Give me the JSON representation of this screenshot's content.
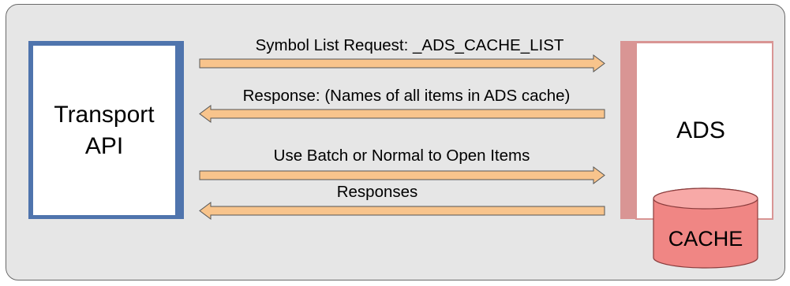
{
  "diagram": {
    "left_box": {
      "label_line1": "Transport",
      "label_line2": "API"
    },
    "right_box": {
      "label": "ADS"
    },
    "cache": {
      "label": "CACHE"
    },
    "arrows": [
      {
        "label": "Symbol List Request: _ADS_CACHE_LIST",
        "direction": "right"
      },
      {
        "label": "Response: (Names of all items in ADS cache)",
        "direction": "left"
      },
      {
        "label": "Use Batch or Normal to Open Items",
        "direction": "right"
      },
      {
        "label": "Responses",
        "direction": "left"
      }
    ],
    "colors": {
      "background": "#e6e6e6",
      "left_box_border": "#4f74ad",
      "right_box_border": "#d99594",
      "cache_fill": "#f08684",
      "arrow_fill": "#f8c48c"
    }
  }
}
